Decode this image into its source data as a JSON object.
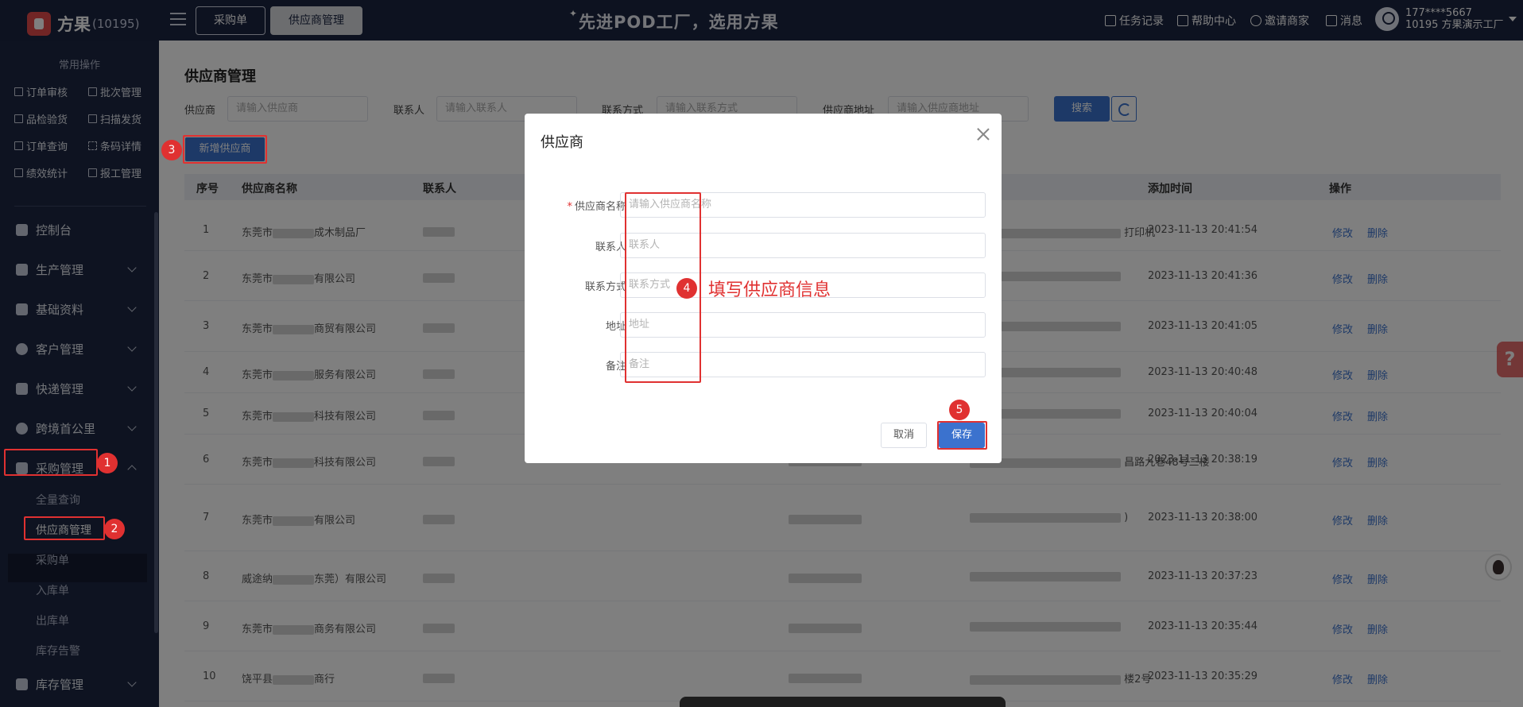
{
  "topbar": {
    "logo_text": "方果",
    "logo_count": "(10195)",
    "tabs": [
      "采购单",
      "供应商管理"
    ],
    "slogan": "先进POD工厂，选用方果",
    "nav": [
      "任务记录",
      "帮助中心",
      "邀请商家",
      "消息"
    ],
    "user_phone": "177****5667",
    "user_org": "10195 方果演示工厂"
  },
  "sidebar": {
    "title": "常用操作",
    "quick_ops": [
      "订单审核",
      "批次管理",
      "品检验货",
      "扫描发货",
      "订单查询",
      "条码详情",
      "绩效统计",
      "报工管理"
    ],
    "menu": [
      "控制台",
      "生产管理",
      "基础资料",
      "客户管理",
      "快递管理",
      "跨境首公里",
      "采购管理",
      "库存管理"
    ],
    "purchase_sub": [
      "全量查询",
      "供应商管理",
      "采购单",
      "入库单",
      "出库单",
      "库存告警"
    ]
  },
  "page": {
    "title": "供应商管理",
    "filters": [
      {
        "label": "供应商",
        "placeholder": "请输入供应商"
      },
      {
        "label": "联系人",
        "placeholder": "请输入联系人"
      },
      {
        "label": "联系方式",
        "placeholder": "请输入联系方式"
      },
      {
        "label": "供应商地址",
        "placeholder": "请输入供应商地址"
      }
    ],
    "search_label": "搜索",
    "add_label": "新增供应商"
  },
  "table": {
    "columns": [
      "序号",
      "供应商名称",
      "联系人",
      "添加时间",
      "操作"
    ],
    "rows": [
      {
        "no": "1",
        "name_a": "东莞市",
        "name_b": "成木制品厂",
        "time": "2023-11-13 20:41:54",
        "addr": "打印机"
      },
      {
        "no": "2",
        "name_a": "东莞市",
        "name_b": "有限公司",
        "time": "2023-11-13 20:41:36",
        "addr": ""
      },
      {
        "no": "3",
        "name_a": "东莞市",
        "name_b": "商贸有限公司",
        "time": "2023-11-13 20:41:05",
        "addr": ""
      },
      {
        "no": "4",
        "name_a": "东莞市",
        "name_b": "服务有限公司",
        "time": "2023-11-13 20:40:48",
        "addr": ""
      },
      {
        "no": "5",
        "name_a": "东莞市",
        "name_b": "科技有限公司",
        "time": "2023-11-13 20:40:04",
        "addr": ""
      },
      {
        "no": "6",
        "name_a": "东莞市",
        "name_b": "科技有限公司",
        "time": "2023-11-13 20:38:19",
        "addr": "昌路九巷48号三楼"
      },
      {
        "no": "7",
        "name_a": "东莞市",
        "name_b": "有限公司",
        "time": "2023-11-13 20:38:00",
        "addr": ")"
      },
      {
        "no": "8",
        "name_a": "威途纳",
        "name_b": "东莞）有限公司",
        "time": "2023-11-13 20:37:23",
        "addr": ""
      },
      {
        "no": "9",
        "name_a": "东莞市",
        "name_b": "商务有限公司",
        "time": "2023-11-13 20:35:44",
        "addr": ""
      },
      {
        "no": "10",
        "name_a": "饶平县",
        "name_b": "商行",
        "time": "2023-11-13 20:35:29",
        "addr": "楼2号"
      }
    ],
    "edit_label": "修改",
    "delete_label": "删除"
  },
  "dialog": {
    "title": "供应商",
    "fields": [
      {
        "label": "供应商名称",
        "placeholder": "请输入供应商名称",
        "required": true
      },
      {
        "label": "联系人",
        "placeholder": "联系人"
      },
      {
        "label": "联系方式",
        "placeholder": "联系方式"
      },
      {
        "label": "地址",
        "placeholder": "地址"
      },
      {
        "label": "备注",
        "placeholder": "备注"
      }
    ],
    "cancel_label": "取消",
    "save_label": "保存"
  },
  "annotations": {
    "steps": [
      "1",
      "2",
      "3",
      "4",
      "5"
    ],
    "note": "填写供应商信息",
    "color": "#e03131"
  },
  "help_glyph": "?"
}
